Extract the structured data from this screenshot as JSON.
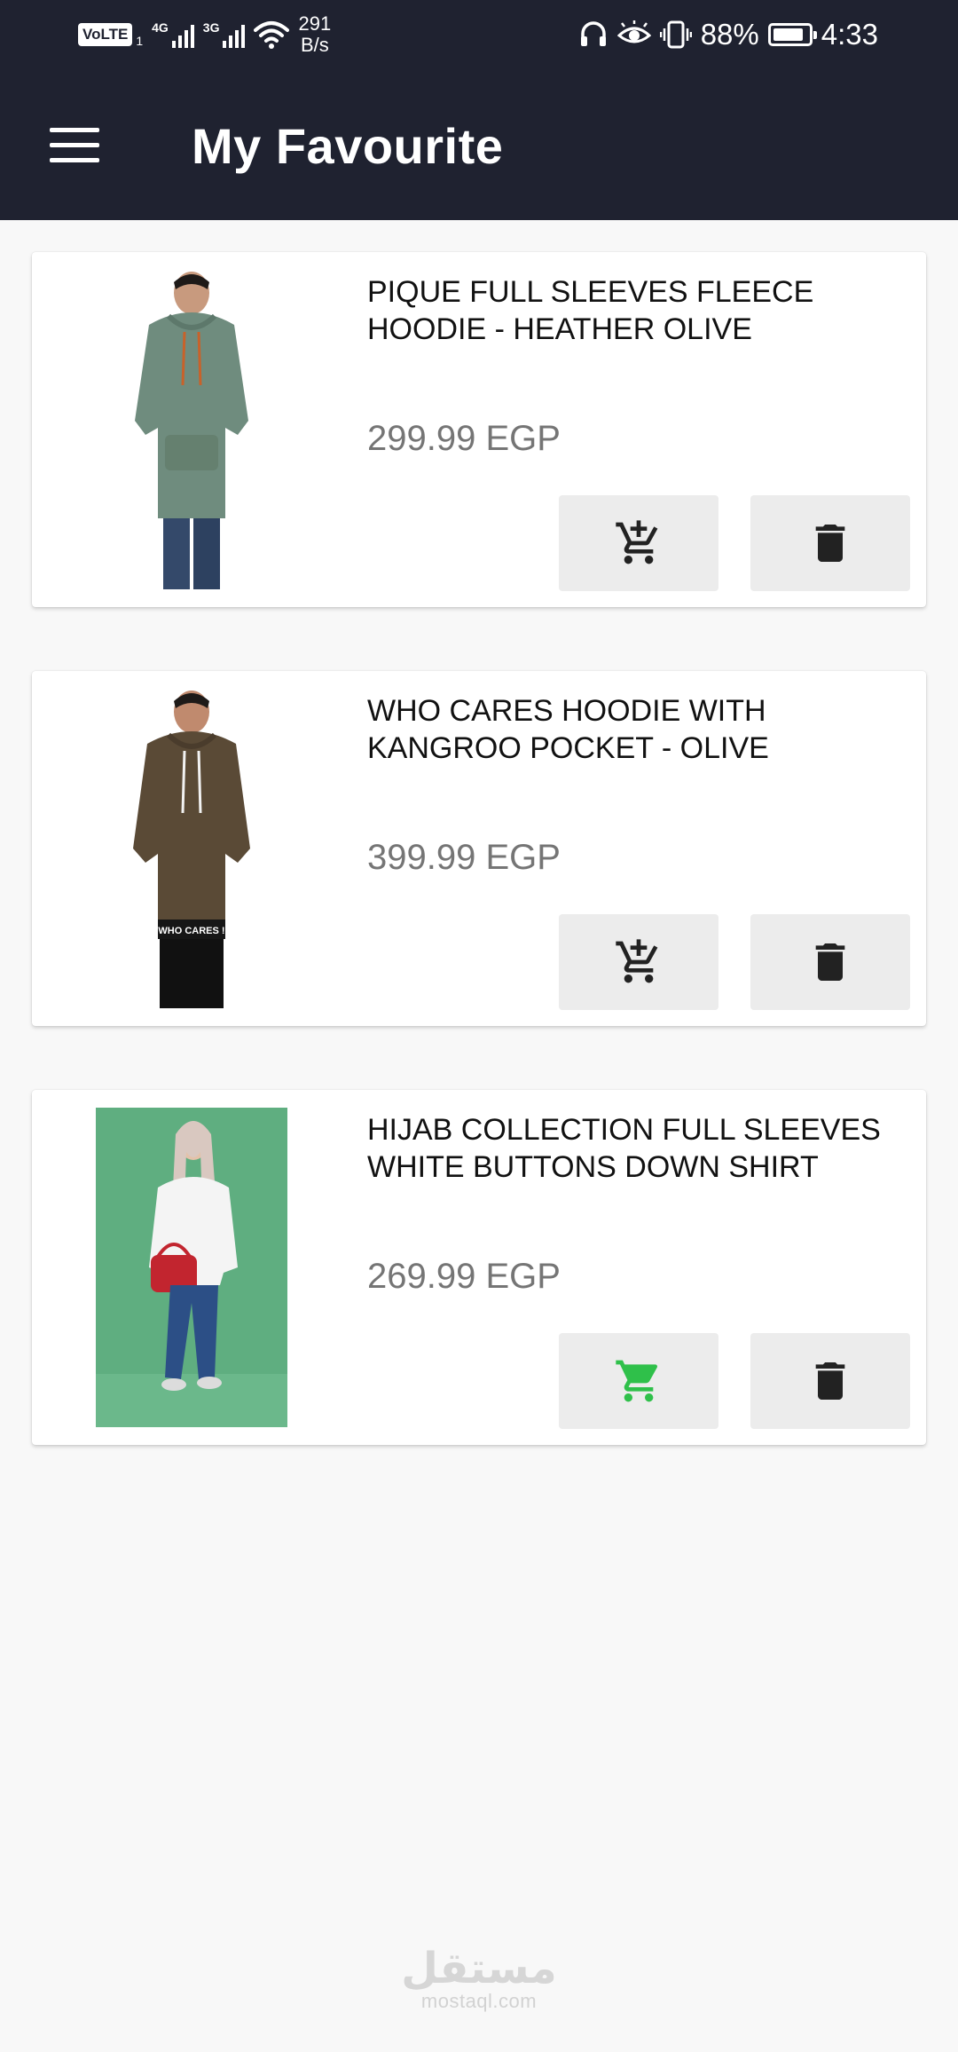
{
  "status_bar": {
    "volte": "VoLTE",
    "sim": "1",
    "net1": "4G",
    "net2": "3G",
    "speed_value": "291",
    "speed_unit": "B/s",
    "battery": "88%",
    "battery_level": 0.88,
    "time": "4:33",
    "icons": [
      "headset-icon",
      "eye-icon",
      "vibrate-icon",
      "battery-icon",
      "wifi-icon",
      "signal-icon"
    ]
  },
  "app_bar": {
    "title": "My Favourite",
    "menu_icon": "menu-icon"
  },
  "favourites": [
    {
      "title": "PIQUE FULL SLEEVES FLEECE HOODIE - HEATHER OLIVE",
      "price": "299.99 EGP",
      "cart_state": "add",
      "cart_icon": "add-shopping-cart-icon",
      "delete_icon": "delete-icon"
    },
    {
      "title": "WHO CARES HOODIE WITH KANGROO POCKET - OLIVE",
      "price": "399.99 EGP",
      "cart_state": "add",
      "cart_icon": "add-shopping-cart-icon",
      "delete_icon": "delete-icon",
      "image_text": "WHO CARES !"
    },
    {
      "title": "HIJAB COLLECTION FULL SLEEVES WHITE BUTTONS DOWN SHIRT",
      "price": "269.99 EGP",
      "cart_state": "in-cart",
      "cart_icon": "shopping-cart-icon",
      "delete_icon": "delete-icon"
    }
  ],
  "colors": {
    "app_bar": "#1f2230",
    "background": "#f8f8f8",
    "card": "#ffffff",
    "button_bg": "#ececec",
    "icon_dark": "#222222",
    "in_cart_green": "#2fc04a",
    "price_grey": "#757575"
  },
  "watermark": {
    "arabic": "مستقل",
    "latin": "mostaql.com"
  }
}
